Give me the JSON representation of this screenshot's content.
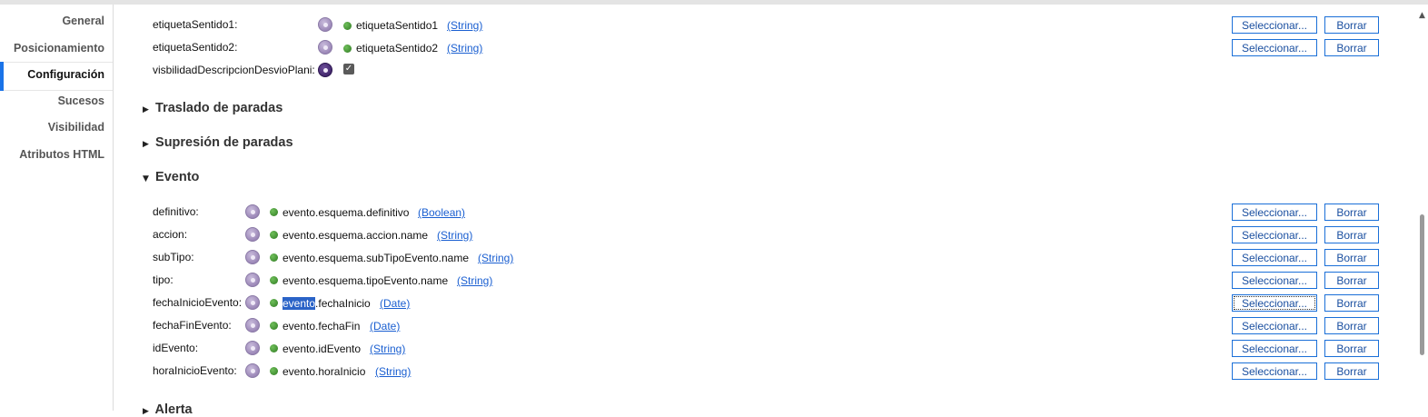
{
  "sidebar": {
    "items": [
      {
        "label": "General"
      },
      {
        "label": "Posicionamiento"
      },
      {
        "label": "Configuración"
      },
      {
        "label": "Sucesos"
      },
      {
        "label": "Visibilidad"
      },
      {
        "label": "Atributos HTML"
      }
    ],
    "active": "Configuración"
  },
  "top_rows": [
    {
      "label": "etiquetaSentido1:",
      "value": "etiquetaSentido1",
      "type": "(String)",
      "select": "Seleccionar...",
      "clear": "Borrar"
    },
    {
      "label": "etiquetaSentido2:",
      "value": "etiquetaSentido2",
      "type": "(String)",
      "select": "Seleccionar...",
      "clear": "Borrar"
    },
    {
      "label": "visbilidadDescripcionDesvioPlani:",
      "checked": true
    }
  ],
  "sections": {
    "traslado": {
      "title": "Traslado de paradas",
      "expanded": false
    },
    "supresion": {
      "title": "Supresión de paradas",
      "expanded": false
    },
    "evento": {
      "title": "Evento",
      "expanded": true
    },
    "alerta": {
      "title": "Alerta",
      "expanded": false
    }
  },
  "evento_rows": [
    {
      "label": "definitivo:",
      "value": "evento.esquema.definitivo",
      "type": "(Boolean)",
      "select": "Seleccionar...",
      "clear": "Borrar"
    },
    {
      "label": "accion:",
      "value": "evento.esquema.accion.name",
      "type": "(String)",
      "select": "Seleccionar...",
      "clear": "Borrar"
    },
    {
      "label": "subTipo:",
      "value": "evento.esquema.subTipoEvento.name",
      "type": "(String)",
      "select": "Seleccionar...",
      "clear": "Borrar"
    },
    {
      "label": "tipo:",
      "value": "evento.esquema.tipoEvento.name",
      "type": "(String)",
      "select": "Seleccionar...",
      "clear": "Borrar"
    },
    {
      "label": "fechaInicioEvento:",
      "value_highlight": "evento",
      "value_rest": ".fechaInicio",
      "type": "(Date)",
      "select": "Seleccionar...",
      "clear": "Borrar"
    },
    {
      "label": "fechaFinEvento:",
      "value": "evento.fechaFin",
      "type": "(Date)",
      "select": "Seleccionar...",
      "clear": "Borrar"
    },
    {
      "label": "idEvento:",
      "value": "evento.idEvento",
      "type": "(String)",
      "select": "Seleccionar...",
      "clear": "Borrar"
    },
    {
      "label": "horaInicioEvento:",
      "value": "evento.horaInicio",
      "type": "(String)",
      "select": "Seleccionar...",
      "clear": "Borrar"
    }
  ],
  "icons": {
    "collapsed": "▶",
    "expanded": "▼",
    "check": "✓",
    "scroll_up": "▲"
  },
  "colors": {
    "accent": "#1a73e8",
    "link": "#1a5fd1",
    "button_border": "#1a6fd8",
    "selection": "#2a63c7"
  }
}
